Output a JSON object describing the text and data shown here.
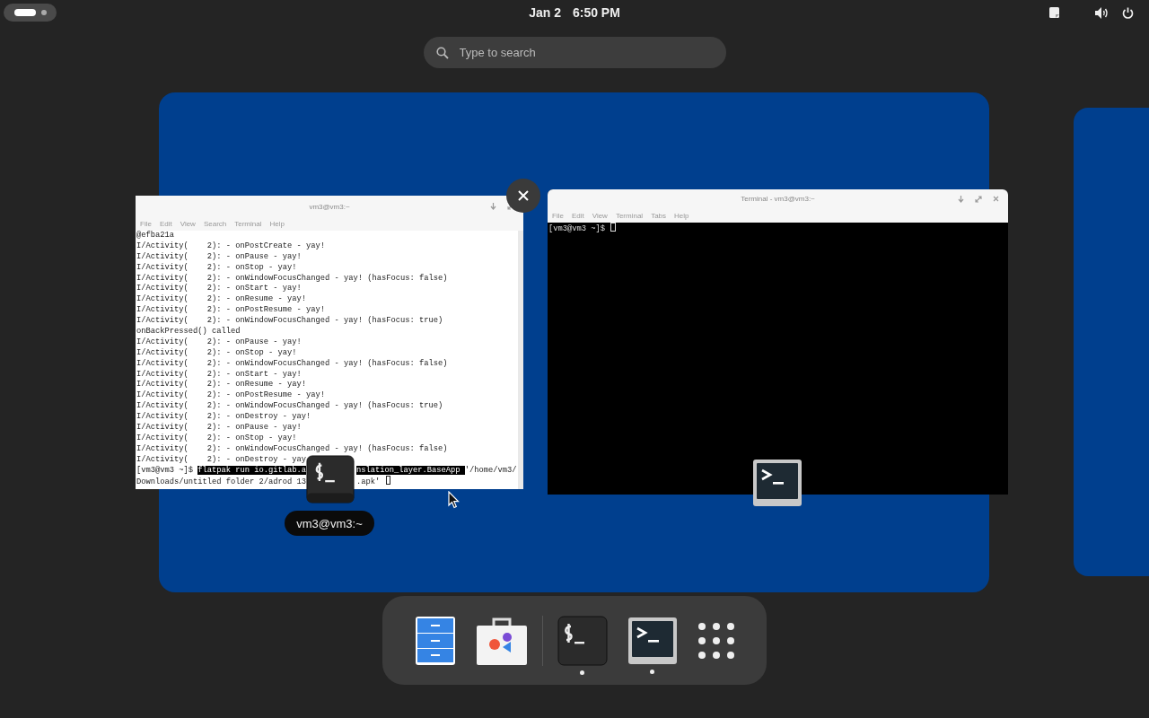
{
  "top_bar": {
    "activities": {
      "selected": true
    },
    "date": "Jan 2",
    "time": "6:50 PM"
  },
  "search": {
    "placeholder": "Type to search"
  },
  "workspaces": [
    {
      "selected": true,
      "windows": [
        {
          "title": "vm3@vm3:~",
          "menu": [
            "File",
            "Edit",
            "View",
            "Search",
            "Terminal",
            "Help"
          ],
          "kind": "terminal",
          "hovered": true,
          "caption": "vm3@vm3:~",
          "lines": [
            "@efba21a",
            "I/Activity(    2): - onPostCreate - yay!",
            "I/Activity(    2): - onPause - yay!",
            "I/Activity(    2): - onStop - yay!",
            "I/Activity(    2): - onWindowFocusChanged - yay! (hasFocus: false)",
            "I/Activity(    2): - onStart - yay!",
            "I/Activity(    2): - onResume - yay!",
            "I/Activity(    2): - onPostResume - yay!",
            "I/Activity(    2): - onWindowFocusChanged - yay! (hasFocus: true)",
            "onBackPressed() called",
            "I/Activity(    2): - onPause - yay!",
            "I/Activity(    2): - onStop - yay!",
            "I/Activity(    2): - onWindowFocusChanged - yay! (hasFocus: false)",
            "I/Activity(    2): - onStart - yay!",
            "I/Activity(    2): - onResume - yay!",
            "I/Activity(    2): - onPostResume - yay!",
            "I/Activity(    2): - onWindowFocusChanged - yay! (hasFocus: true)",
            "I/Activity(    2): - onDestroy - yay!",
            "I/Activity(    2): - onPause - yay!",
            "I/Activity(    2): - onStop - yay!",
            "I/Activity(    2): - onWindowFocusChanged - yay! (hasFocus: false)",
            "I/Activity(    2): - onDestroy - yay",
            {
              "chunks": [
                [
                  {
                    "text": "[vm3@vm3 ~]$ ",
                    "highlight": false
                  },
                  {
                    "text": "flatpak run io.gitlab.a",
                    "highlight": true
                  }
                ],
                [
                  {
                    "text": "nslation_layer.BaseApp ",
                    "highlight": true
                  },
                  {
                    "text": "'/home/vm3/",
                    "highlight": false
                  }
                ]
              ]
            },
            {
              "cursor": true,
              "chunks": [
                [
                  {
                    "text": "Downloads/untitled folder 2/adrod 13",
                    "highlight": false
                  }
                ],
                [
                  {
                    "text": ".apk' ",
                    "highlight": false
                  }
                ]
              ]
            }
          ]
        },
        {
          "title": "Terminal - vm3@vm3:~",
          "menu": [
            "File",
            "Edit",
            "View",
            "Terminal",
            "Tabs",
            "Help"
          ],
          "kind": "console",
          "hovered": false,
          "lines": [
            {
              "cursor": true,
              "chunks": [
                [
                  {
                    "text": "[vm3@vm3 ~]$ ",
                    "highlight": false
                  }
                ]
              ]
            }
          ]
        }
      ]
    },
    {
      "selected": false
    }
  ],
  "dock": [
    {
      "kind": "files",
      "running": false
    },
    {
      "kind": "software",
      "running": false
    },
    {
      "kind": "separator"
    },
    {
      "kind": "terminal",
      "running": true
    },
    {
      "kind": "console",
      "running": true
    },
    {
      "kind": "apps",
      "running": false
    }
  ]
}
